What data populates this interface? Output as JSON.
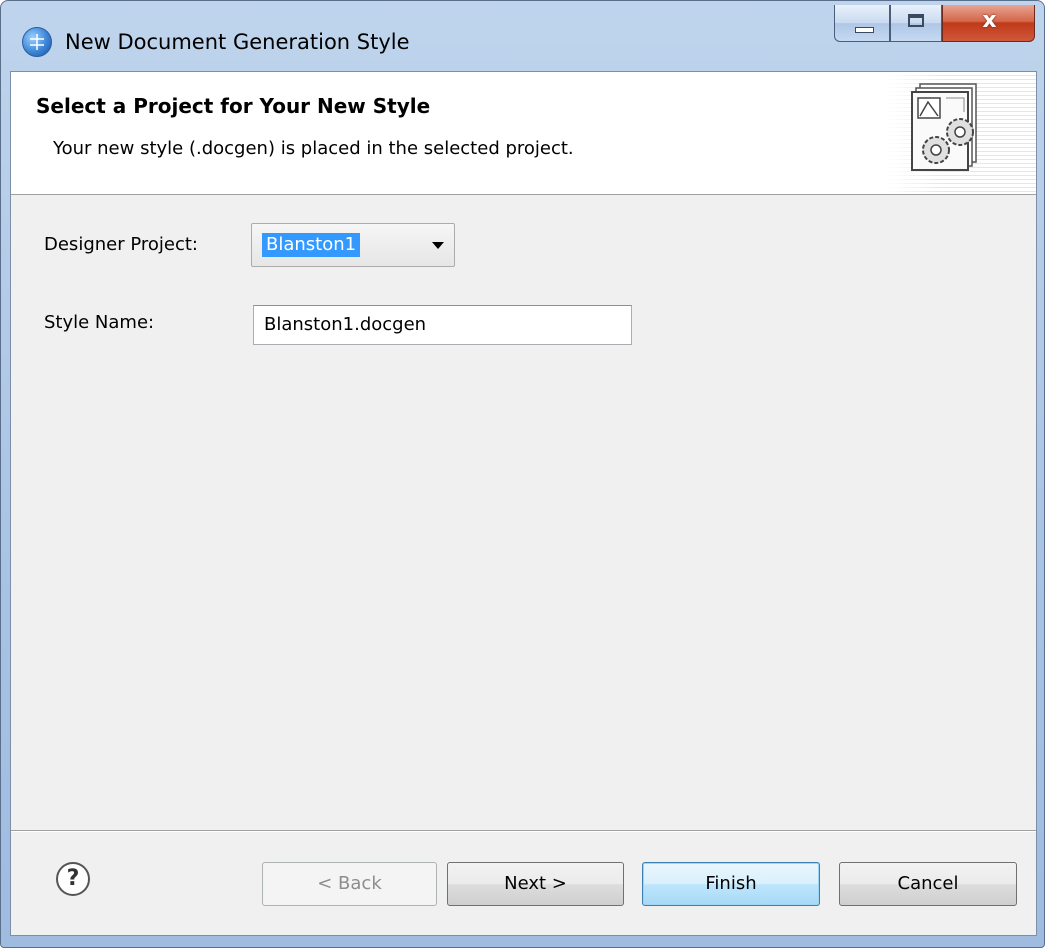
{
  "window": {
    "title": "New Document Generation Style",
    "close_glyph": "x"
  },
  "header": {
    "title": "Select a Project for Your New Style",
    "description": "Your new style (.docgen) is placed in the selected project."
  },
  "form": {
    "designer_project_label": "Designer Project:",
    "designer_project_value": "Blanston1",
    "style_name_label": "Style Name:",
    "style_name_value": "Blanston1.docgen"
  },
  "footer": {
    "help_glyph": "?",
    "back_label": "< Back",
    "next_label": "Next >",
    "finish_label": "Finish",
    "cancel_label": "Cancel"
  },
  "icons": {
    "app": "eclipse-globe-icon",
    "wizard": "document-gears-icon",
    "help": "help-icon"
  }
}
